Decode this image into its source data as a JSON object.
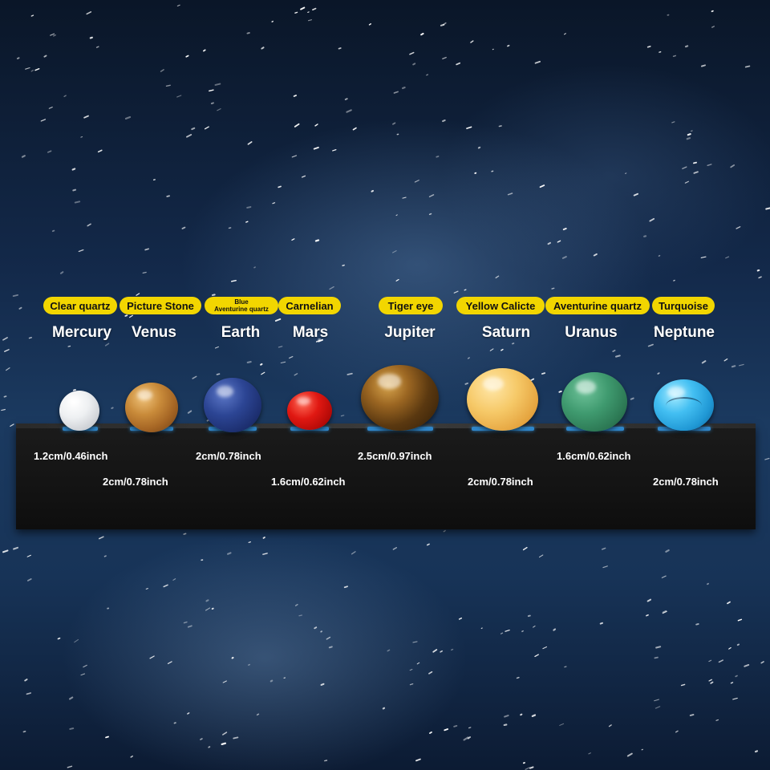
{
  "stones": [
    {
      "stone": "Clear quartz",
      "planet": "Mercury",
      "size": "1.2cm/0.46inch"
    },
    {
      "stone": "Picture Stone",
      "planet": "Venus",
      "size": "2cm/0.78inch"
    },
    {
      "stone_line1": "Blue",
      "stone_line2": "Aventurine quartz",
      "planet": "Earth",
      "size": "2cm/0.78inch"
    },
    {
      "stone": "Carnelian",
      "planet": "Mars",
      "size": "1.6cm/0.62inch"
    },
    {
      "stone": "Tiger eye",
      "planet": "Jupiter",
      "size": "2.5cm/0.97inch"
    },
    {
      "stone": "Yellow Calicte",
      "planet": "Saturn",
      "size": "2cm/0.78inch"
    },
    {
      "stone": "Aventurine quartz",
      "planet": "Uranus",
      "size": "1.6cm/0.62inch"
    },
    {
      "stone": "Turquoise",
      "planet": "Neptune",
      "size": "2cm/0.78inch"
    }
  ],
  "colors": {
    "label_background": "#f2d600",
    "slot_accent": "#2f86c9",
    "box": "#111111"
  }
}
